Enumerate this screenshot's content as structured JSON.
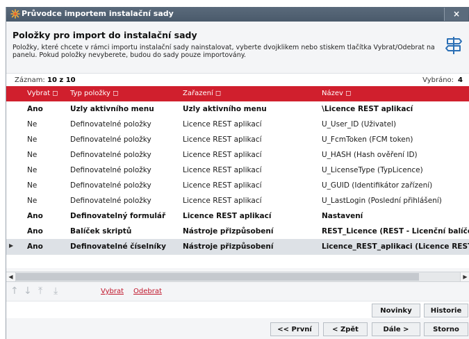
{
  "window": {
    "title": "Průvodce importem instalační sady",
    "close_label": "×"
  },
  "header": {
    "title": "Položky pro import do instalační sady",
    "description": "Položky, které chcete v rámci importu instalační sady nainstalovat, vyberte dvojklikem nebo stiskem tlačítka Vybrat/Odebrat na panelu. Pokud položky nevyberete, budou do sady pouze importovány."
  },
  "info": {
    "records_label": "Záznam:",
    "records_value": "10 z 10",
    "selected_label": "Vybráno:",
    "selected_value": "4"
  },
  "grid": {
    "columns": [
      "Vybrat ◻",
      "Typ položky ◻",
      "Zařazení ◻",
      "Název ◻"
    ],
    "rows": [
      {
        "select": "Ano",
        "type": "Uzly aktivního menu",
        "category": "Uzly aktivního menu",
        "name": "\\Licence REST aplikací",
        "bold": true
      },
      {
        "select": "Ne",
        "type": "Definovatelné položky",
        "category": "Licence REST aplikací",
        "name": "U_User_ID (Uživatel)",
        "bold": false
      },
      {
        "select": "Ne",
        "type": "Definovatelné položky",
        "category": "Licence REST aplikací",
        "name": "U_FcmToken (FCM token)",
        "bold": false
      },
      {
        "select": "Ne",
        "type": "Definovatelné položky",
        "category": "Licence REST aplikací",
        "name": "U_HASH (Hash ověření ID)",
        "bold": false
      },
      {
        "select": "Ne",
        "type": "Definovatelné položky",
        "category": "Licence REST aplikací",
        "name": "U_LicenseType (TypLicence)",
        "bold": false
      },
      {
        "select": "Ne",
        "type": "Definovatelné položky",
        "category": "Licence REST aplikací",
        "name": "U_GUID (Identifikátor zařízení)",
        "bold": false
      },
      {
        "select": "Ne",
        "type": "Definovatelné položky",
        "category": "Licence REST aplikací",
        "name": "U_LastLogin (Poslední přihlášení)",
        "bold": false
      },
      {
        "select": "Ano",
        "type": "Definovatelný formulář",
        "category": "Licence REST aplikací",
        "name": "Nastavení",
        "bold": true
      },
      {
        "select": "Ano",
        "type": "Balíček skriptů",
        "category": "Nástroje přizpůsobení",
        "name": "REST_Licence (REST - Licenční balíček)",
        "bold": true
      },
      {
        "select": "Ano",
        "type": "Definovatelné číselníky",
        "category": "Nástroje přizpůsobení",
        "name": "Licence_REST_aplikaci (Licence REST ap",
        "bold": true,
        "current": true
      }
    ]
  },
  "toolbar": {
    "arrows": [
      "↑",
      "↓",
      "⤒",
      "⤓"
    ],
    "select_link": "Vybrat",
    "remove_link": "Odebrat"
  },
  "buttons": {
    "news": "Novinky",
    "history": "Historie",
    "first": "<< První",
    "back": "< Zpět",
    "next": "Dále >",
    "cancel": "Storno"
  },
  "colors": {
    "accent_red": "#d01f2d",
    "titlebar": "#4f5f70",
    "selected_row": "#dde1e6"
  },
  "icons": {
    "title": "wizard-star-icon",
    "header": "signpost-icon"
  }
}
